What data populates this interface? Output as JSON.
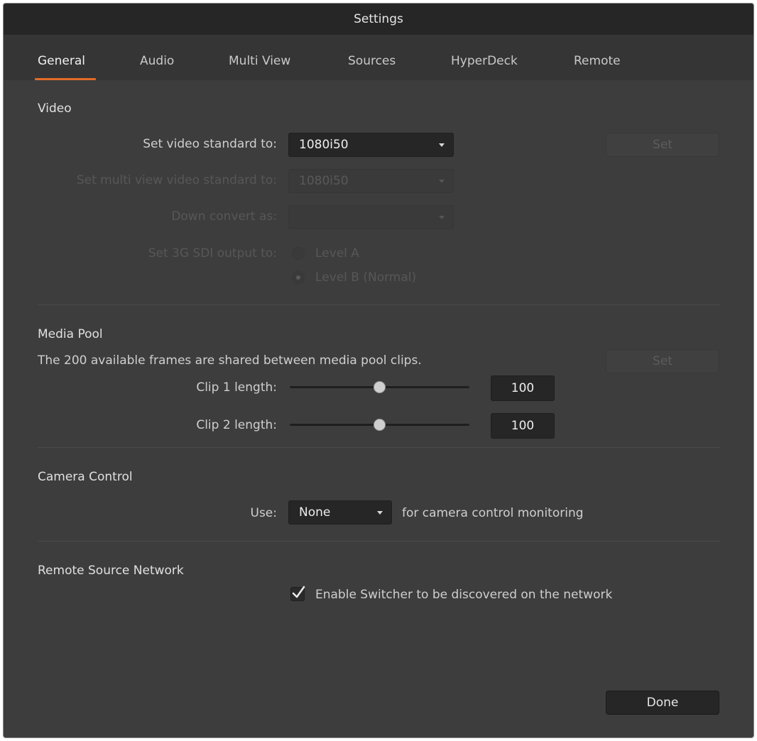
{
  "window": {
    "title": "Settings"
  },
  "tabs": [
    {
      "label": "General",
      "active": true
    },
    {
      "label": "Audio"
    },
    {
      "label": "Multi View"
    },
    {
      "label": "Sources"
    },
    {
      "label": "HyperDeck"
    },
    {
      "label": "Remote"
    }
  ],
  "video": {
    "title": "Video",
    "standard_label": "Set video standard to:",
    "standard_value": "1080i50",
    "set_label": "Set",
    "multiview_label": "Set multi view video standard to:",
    "multiview_value": "1080i50",
    "down_convert_label": "Down convert as:",
    "down_convert_value": "",
    "sdi_label": "Set 3G SDI output to:",
    "level_a": "Level A",
    "level_b": "Level B (Normal)"
  },
  "media_pool": {
    "title": "Media Pool",
    "description": "The 200 available frames are shared between media pool clips.",
    "set_label": "Set",
    "clip1_label": "Clip 1 length:",
    "clip1_value": "100",
    "clip2_label": "Clip 2 length:",
    "clip2_value": "100"
  },
  "camera_control": {
    "title": "Camera Control",
    "use_label": "Use:",
    "use_value": "None",
    "suffix": "for camera control monitoring"
  },
  "remote_source": {
    "title": "Remote Source Network",
    "enable_label": "Enable Switcher to be discovered on the network",
    "enabled": true
  },
  "footer": {
    "done_label": "Done"
  },
  "colors": {
    "accent": "#e36b2a",
    "background": "#3d3d3d",
    "titlebar": "#262626"
  },
  "icons": {
    "dropdown": "chevron-down-icon",
    "check": "checkmark-icon"
  }
}
